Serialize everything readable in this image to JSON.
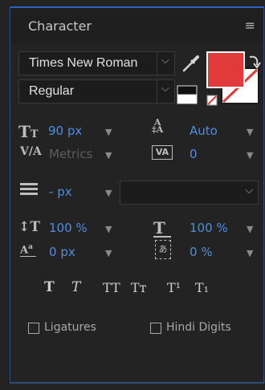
{
  "panel": {
    "title": "Character",
    "menu_glyph": "≡"
  },
  "font": {
    "family": "Times New Roman",
    "style": "Regular",
    "chevron": "⌵"
  },
  "size": {
    "value": "90",
    "unit": "px"
  },
  "leading": {
    "value": "Auto"
  },
  "kerning": {
    "value": "Metrics"
  },
  "tracking": {
    "value": "0"
  },
  "stroke": {
    "value": "-",
    "unit": "px"
  },
  "vertical_scale": {
    "value": "100",
    "unit": "%"
  },
  "horizontal_scale": {
    "value": "100",
    "unit": "%"
  },
  "baseline_shift": {
    "value": "0",
    "unit": "px"
  },
  "tsume": {
    "value": "0",
    "unit": "%"
  },
  "format_buttons": [
    "T",
    "T",
    "TT",
    "Tт",
    "T¹",
    "T₁"
  ],
  "checkboxes": {
    "ligatures": "Ligatures",
    "hindi_digits": "Hindi Digits"
  },
  "colors": {
    "fill": "#e03a3a",
    "stroke_none": "#ffffff",
    "accent": "#4e8fe0"
  },
  "icons": {
    "eyedropper": "eyedropper-icon",
    "swap": "swap-colors-icon",
    "black_white": "default-colors-icon",
    "none_fill": "no-fill-icon",
    "none_stroke": "no-stroke-icon"
  },
  "dropdown_arrow": "▼"
}
